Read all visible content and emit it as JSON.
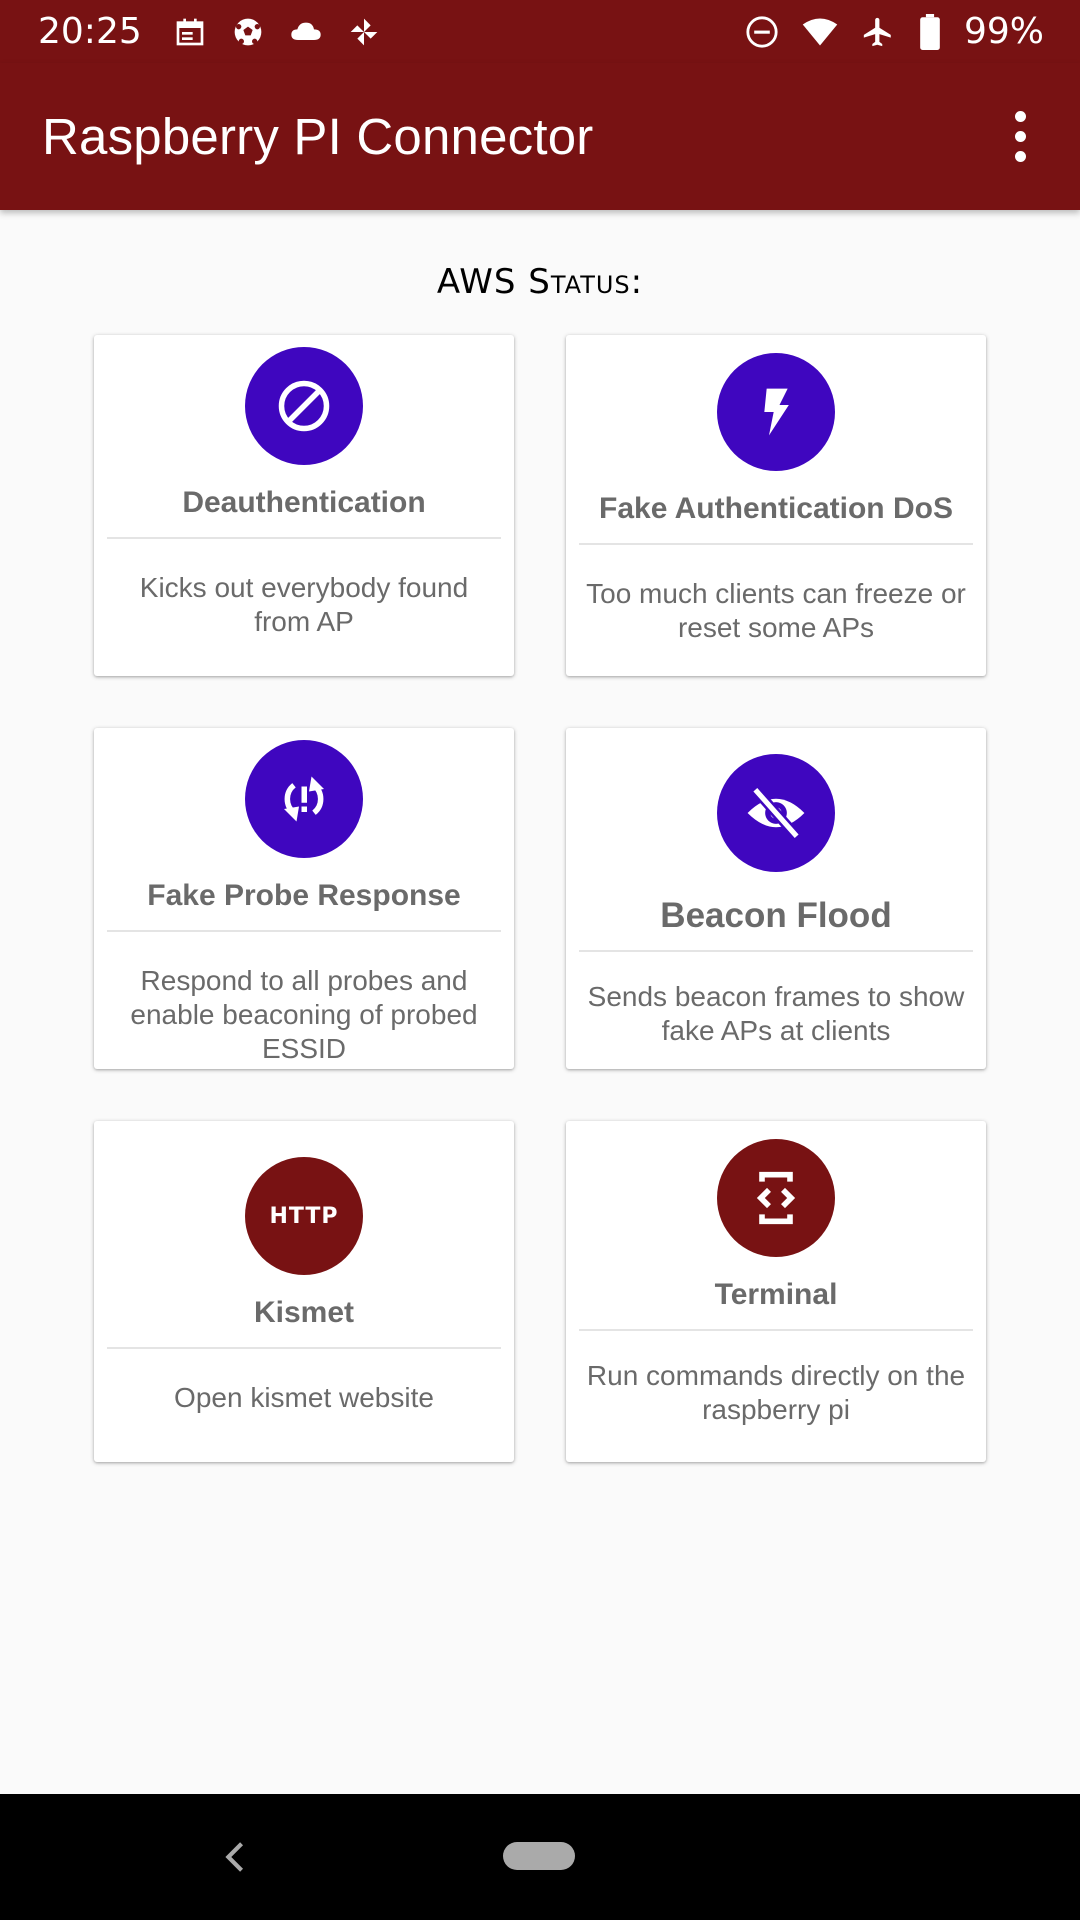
{
  "status_bar": {
    "time": "20:25",
    "left_icons": [
      "calendar-icon",
      "soccer-ball-icon",
      "cloud-icon",
      "pinwheel-icon"
    ],
    "right_icons": [
      "do-not-disturb-icon",
      "wifi-icon",
      "airplane-icon",
      "battery-icon"
    ],
    "battery": "99%"
  },
  "app_bar": {
    "title": "Raspberry PI Connector",
    "menu_icon": "more-vert-icon"
  },
  "section_title": "AWS Status:",
  "cards": [
    {
      "title": "Deauthentication",
      "description": "Kicks out everybody found from AP",
      "icon": "block-icon",
      "color": "#3f06bf"
    },
    {
      "title": "Fake Authentication DoS",
      "description": "Too much clients can freeze or reset some APs",
      "icon": "flash-icon",
      "color": "#3f06bf"
    },
    {
      "title": "Fake Probe Response",
      "description": "Respond to all probes and enable beaconing of probed ESSID",
      "icon": "sync-problem-icon",
      "color": "#3f06bf"
    },
    {
      "title": "Beacon Flood",
      "description": "Sends beacon frames to show fake APs at clients",
      "icon": "visibility-off-icon",
      "color": "#3f06bf"
    },
    {
      "title": "Kismet",
      "description": "Open kismet website",
      "icon": "http-icon",
      "icon_text": "HTTP",
      "color": "#781213"
    },
    {
      "title": "Terminal",
      "description": "Run commands directly on the raspberry pi",
      "icon": "developer-mode-icon",
      "color": "#781213"
    }
  ],
  "colors": {
    "primary": "#781213",
    "accent": "#3f06bf"
  },
  "nav_bar": {
    "back_icon": "back-icon",
    "home_icon": "home-pill-icon"
  }
}
